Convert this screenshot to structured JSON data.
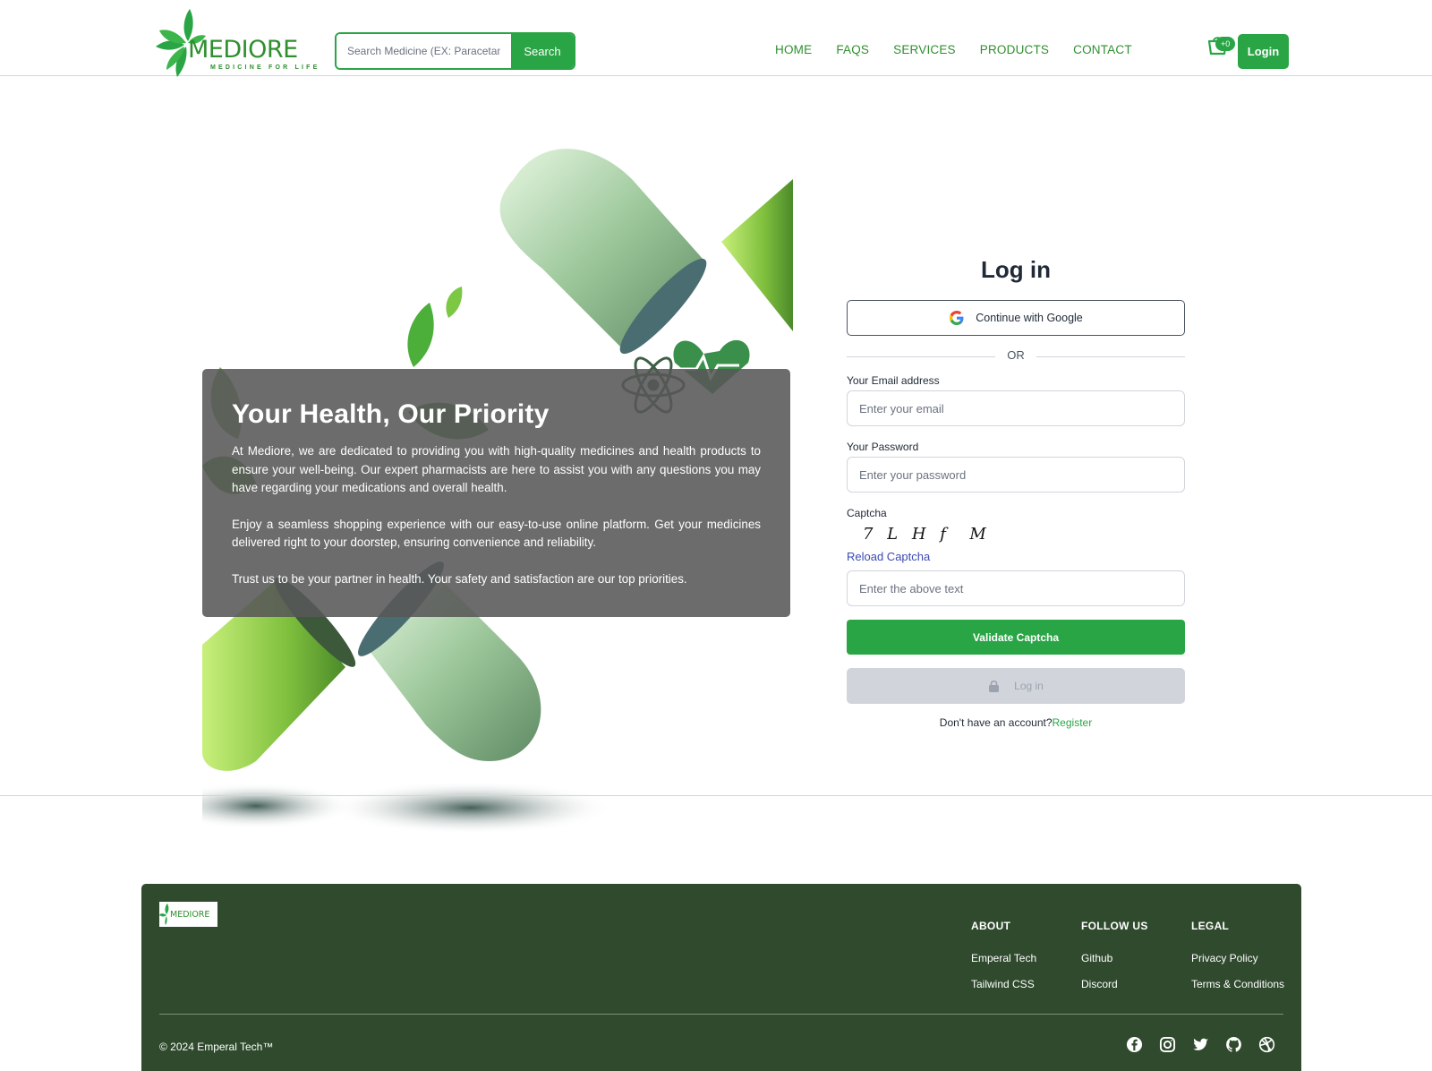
{
  "header": {
    "logo_text": "MEDIORE",
    "logo_tagline": "MEDICINE FOR LIFE",
    "search_placeholder": "Search Medicine (EX: Paracetamol)",
    "search_button": "Search",
    "nav": [
      "HOME",
      "FAQS",
      "SERVICES",
      "PRODUCTS",
      "CONTACT"
    ],
    "cart_count": "+0",
    "login_button": "Login"
  },
  "hero": {
    "title": "Your Health, Our Priority",
    "paragraphs": [
      "At Mediore, we are dedicated to providing you with high-quality medicines and health products to ensure your well-being. Our expert pharmacists are here to assist you with any questions you may have regarding your medications and overall health.",
      "Enjoy a seamless shopping experience with our easy-to-use online platform. Get your medicines delivered right to your doorstep, ensuring convenience and reliability.",
      "Trust us to be your partner in health. Your safety and satisfaction are our top priorities."
    ]
  },
  "login": {
    "title": "Log in",
    "google_button": "Continue with Google",
    "or_text": "OR",
    "email_label": "Your Email address",
    "email_placeholder": "Enter your email",
    "password_label": "Your Password",
    "password_placeholder": "Enter your password",
    "captcha_label": "Captcha",
    "captcha_text": "7 L H f  M",
    "reload_captcha": "Reload Captcha",
    "captcha_placeholder": "Enter the above text",
    "validate_button": "Validate Captcha",
    "login_button": "Log in",
    "no_account_text": "Don't have an account?",
    "register_link": "Register"
  },
  "footer": {
    "logo_text": "MEDIORE",
    "columns": [
      {
        "heading": "ABOUT",
        "links": [
          "Emperal Tech",
          "Tailwind CSS"
        ]
      },
      {
        "heading": "FOLLOW US",
        "links": [
          "Github",
          "Discord"
        ]
      },
      {
        "heading": "LEGAL",
        "links": [
          "Privacy Policy",
          "Terms & Conditions"
        ]
      }
    ],
    "copyright": "© 2024 Emperal Tech™",
    "social_icons": [
      "facebook-icon",
      "instagram-icon",
      "twitter-icon",
      "github-icon",
      "dribbble-icon"
    ]
  },
  "colors": {
    "brand_green": "#2aa545",
    "footer_bg": "#2f4a2d",
    "hero_card": "#585858"
  }
}
